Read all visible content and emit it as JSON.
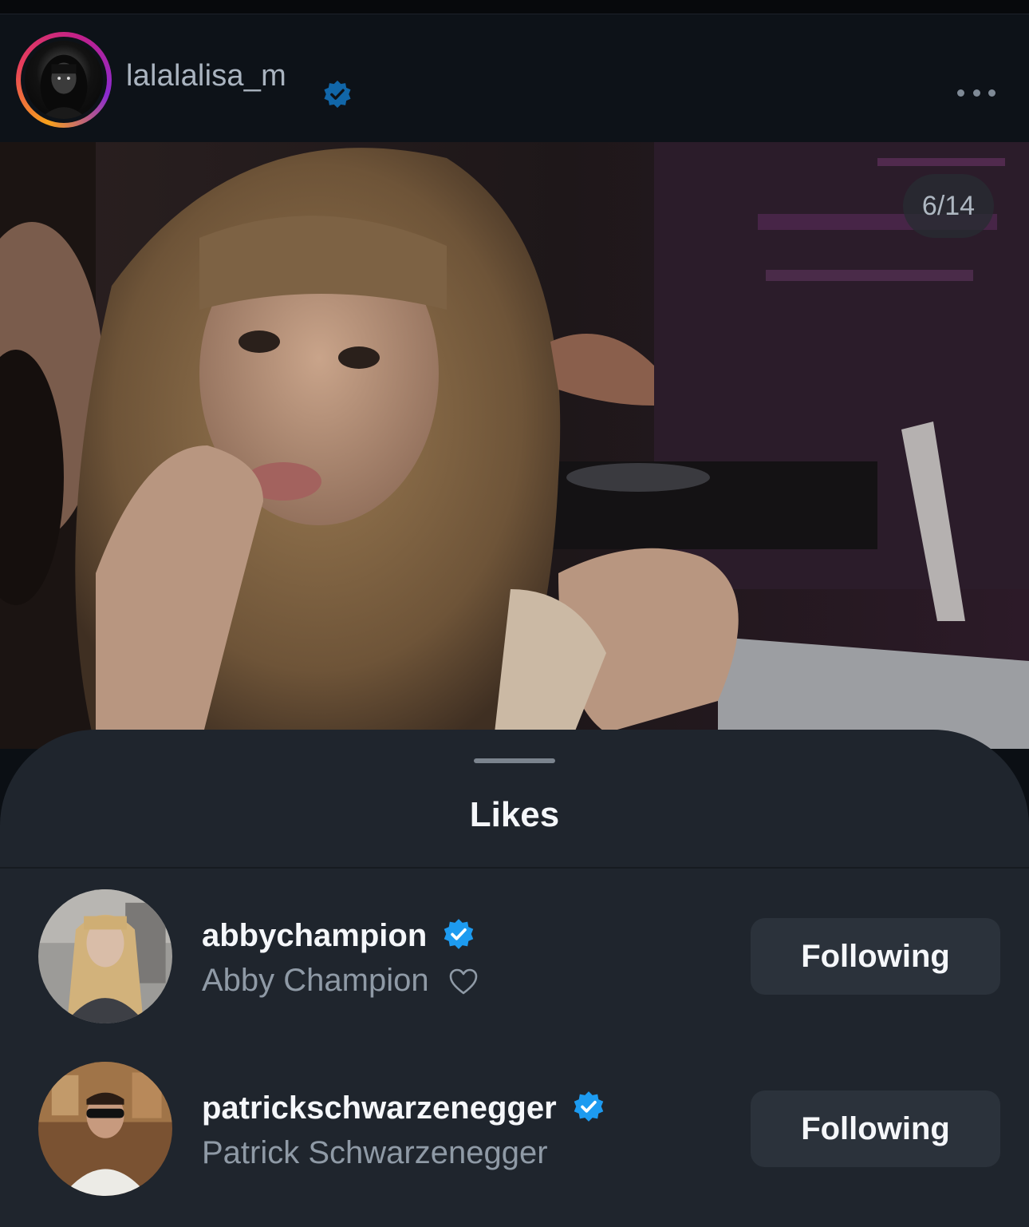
{
  "post": {
    "username": "lalalalisa_m",
    "verified": true,
    "photo_counter": "6/14"
  },
  "likes_sheet": {
    "title": "Likes",
    "users": [
      {
        "handle": "abbychampion",
        "name": "Abby Champion",
        "verified": true,
        "button": "Following"
      },
      {
        "handle": "patrickschwarzenegger",
        "name": "Patrick Schwarzenegger",
        "verified": true,
        "button": "Following"
      }
    ]
  },
  "colors": {
    "background": "#0d1218",
    "sheet": "#1f252d",
    "verified_blue": "#1d9bf0",
    "button": "#2b323b"
  }
}
